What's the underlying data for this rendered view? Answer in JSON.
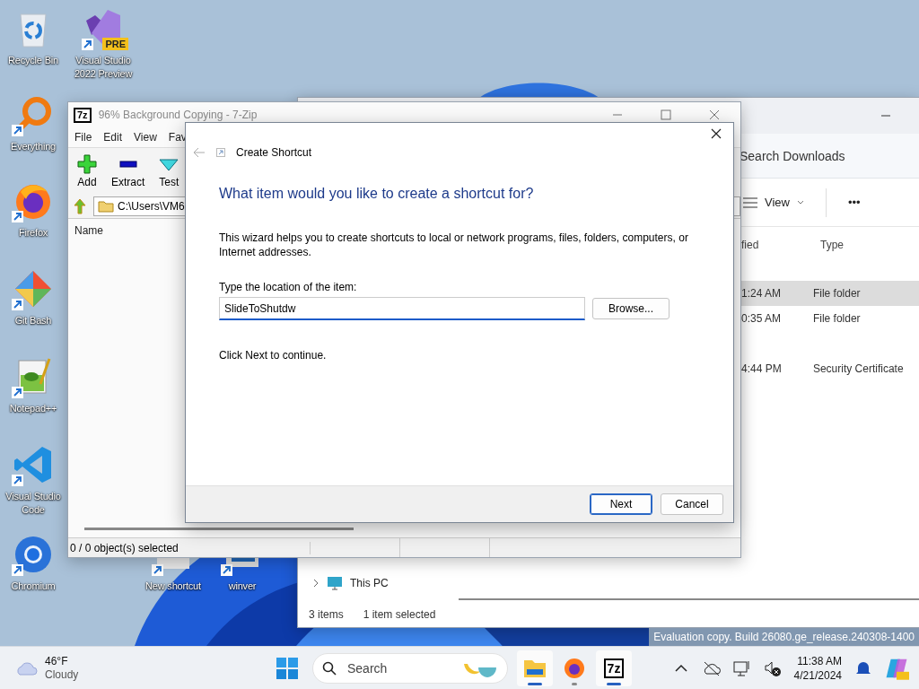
{
  "desktop": {
    "icons": [
      {
        "label": "Recycle Bin",
        "shortcut": false
      },
      {
        "label": "Visual Studio 2022 Preview",
        "shortcut": true,
        "badge": "PRE"
      },
      {
        "label": "Everything",
        "shortcut": true
      },
      {
        "label": "Firefox",
        "shortcut": true
      },
      {
        "label": "Git Bash",
        "shortcut": true
      },
      {
        "label": "Notepad++",
        "shortcut": true
      },
      {
        "label": "Visual Studio Code",
        "shortcut": true
      },
      {
        "label": "Chromium",
        "shortcut": true
      },
      {
        "label": "New shortcut",
        "shortcut": true
      },
      {
        "label": "winver",
        "shortcut": true
      }
    ]
  },
  "explorer": {
    "search": {
      "placeholder": "Search Downloads"
    },
    "view_button": "View",
    "more_button": "•••",
    "columns": [
      "fied",
      "Type"
    ],
    "rows": [
      {
        "cells": [
          "1:24 AM",
          "File folder"
        ],
        "selected": true
      },
      {
        "cells": [
          "0:35 AM",
          "File folder"
        ],
        "selected": false
      },
      {
        "cells": [
          "4:44 PM",
          "Security Certificate"
        ],
        "selected": false
      }
    ],
    "nav": [
      {
        "label": "This PC",
        "expanded": false
      }
    ],
    "status": {
      "count": "3 items",
      "selection": "1 item selected"
    }
  },
  "sevenzip": {
    "title": "96% Background Copying - 7-Zip",
    "logo": "7z",
    "menu": [
      "File",
      "Edit",
      "View",
      "Fav"
    ],
    "toolbar": [
      "Add",
      "Extract",
      "Test"
    ],
    "path": "C:\\Users\\VM6",
    "columns": [
      "Name"
    ],
    "status": "0 / 0 object(s) selected"
  },
  "dialog": {
    "title": "Create Shortcut",
    "heading": "What item would you like to create a shortcut for?",
    "intro": "This wizard helps you to create shortcuts to local or network programs, files, folders, computers, or Internet addresses.",
    "field": {
      "label": "Type the location of the item:",
      "value": "SlideToShutdw"
    },
    "browse": "Browse...",
    "hint": "Click Next to continue.",
    "buttons": [
      {
        "label": "Next",
        "default": true
      },
      {
        "label": "Cancel",
        "default": false
      }
    ]
  },
  "build_notice": "Evaluation copy. Build 26080.ge_release.240308-1400",
  "taskbar": {
    "weather": {
      "temperature": "46°F",
      "condition": "Cloudy"
    },
    "search": {
      "placeholder": "Search"
    },
    "apps": [
      {
        "active": true
      },
      {
        "active": false
      },
      {
        "active": true,
        "logo": "7z"
      }
    ],
    "clock": {
      "time": "11:38 AM",
      "date": "4/21/2024"
    }
  }
}
